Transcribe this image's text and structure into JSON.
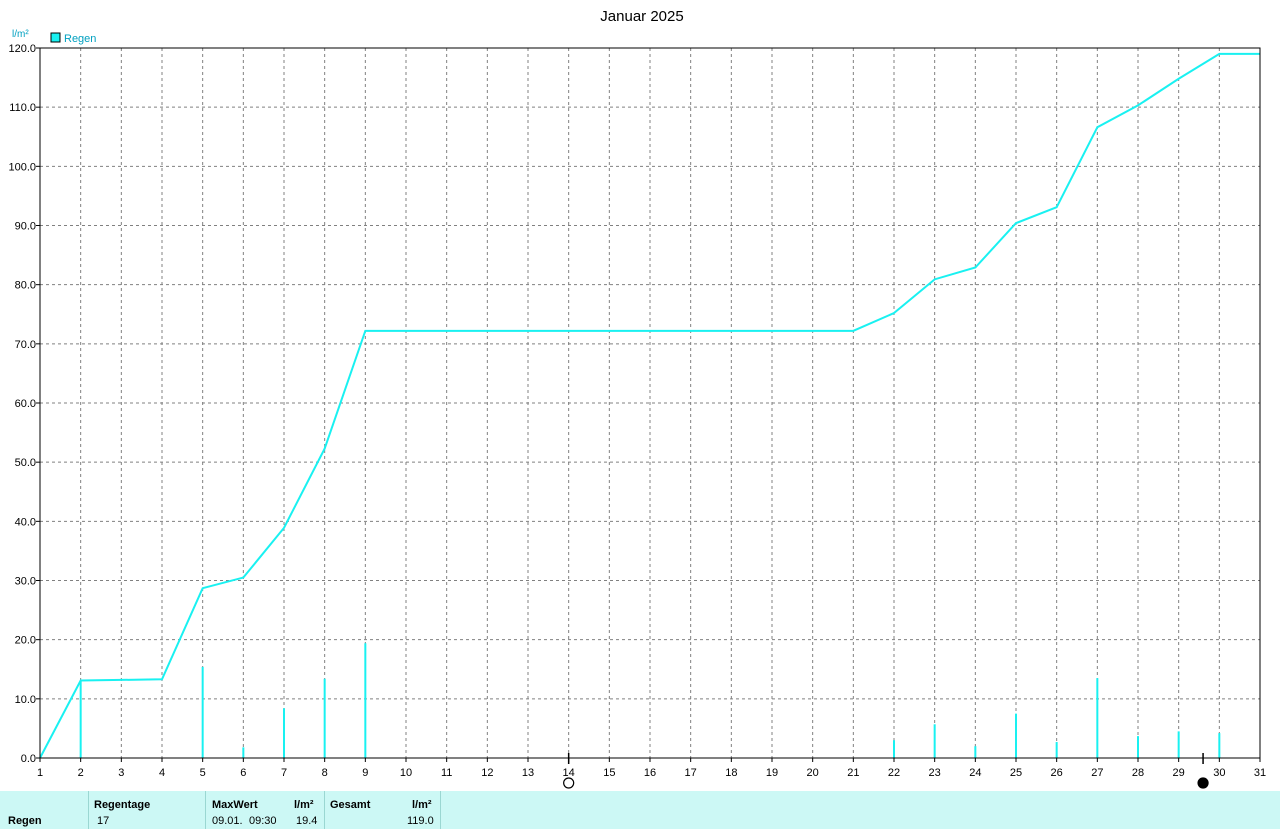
{
  "chart_data": {
    "type": "line",
    "title": "Januar 2025",
    "ylabel": "l/m²",
    "legend": "top-left",
    "series_name": "Regen",
    "color": "#19f1f1",
    "grid": true,
    "xlim": [
      1,
      31
    ],
    "ylim": [
      0,
      120
    ],
    "x_ticks": [
      1,
      2,
      3,
      4,
      5,
      6,
      7,
      8,
      9,
      10,
      11,
      12,
      13,
      14,
      15,
      16,
      17,
      18,
      19,
      20,
      21,
      22,
      23,
      24,
      25,
      26,
      27,
      28,
      29,
      30,
      31
    ],
    "y_ticks": [
      "0.0",
      "10.0",
      "20.0",
      "30.0",
      "40.0",
      "50.0",
      "60.0",
      "70.0",
      "80.0",
      "90.0",
      "100.0",
      "110.0",
      "120.0"
    ],
    "cumulative": {
      "x": [
        1,
        2,
        3,
        4,
        5,
        6,
        7,
        8,
        9,
        10,
        11,
        12,
        13,
        14,
        15,
        16,
        17,
        18,
        19,
        20,
        21,
        22,
        23,
        24,
        25,
        26,
        27,
        28,
        29,
        30,
        31
      ],
      "y": [
        0,
        13.1,
        13.2,
        13.3,
        28.7,
        30.5,
        38.9,
        52.3,
        72.2,
        72.2,
        72.2,
        72.2,
        72.2,
        72.2,
        72.2,
        72.2,
        72.2,
        72.2,
        72.2,
        72.2,
        72.2,
        75.2,
        80.9,
        82.9,
        90.4,
        93.1,
        106.6,
        110.3,
        114.8,
        119.0,
        119.0
      ]
    },
    "daily": {
      "x": [
        2,
        5,
        6,
        7,
        8,
        9,
        22,
        23,
        24,
        25,
        26,
        27,
        28,
        29,
        30
      ],
      "y": [
        13.1,
        15.4,
        1.8,
        8.4,
        13.4,
        19.4,
        3.0,
        5.7,
        2.0,
        7.5,
        2.7,
        13.5,
        3.7,
        4.5,
        4.2
      ]
    },
    "moon_markers": [
      {
        "x": 14,
        "phase": "full-moon"
      },
      {
        "x": 29.6,
        "phase": "new-moon"
      }
    ]
  },
  "legend": {
    "label": "Regen"
  },
  "footer": {
    "row_label": "Regen",
    "regentage_header": "Regentage",
    "regentage_value": "17",
    "maxwert_header": "MaxWert",
    "maxwert_unit": "l/m²",
    "maxwert_date": "09.01.",
    "maxwert_time": "09:30",
    "maxwert_value": "19.4",
    "gesamt_header": "Gesamt",
    "gesamt_unit": "l/m²",
    "gesamt_value": "119.0"
  }
}
